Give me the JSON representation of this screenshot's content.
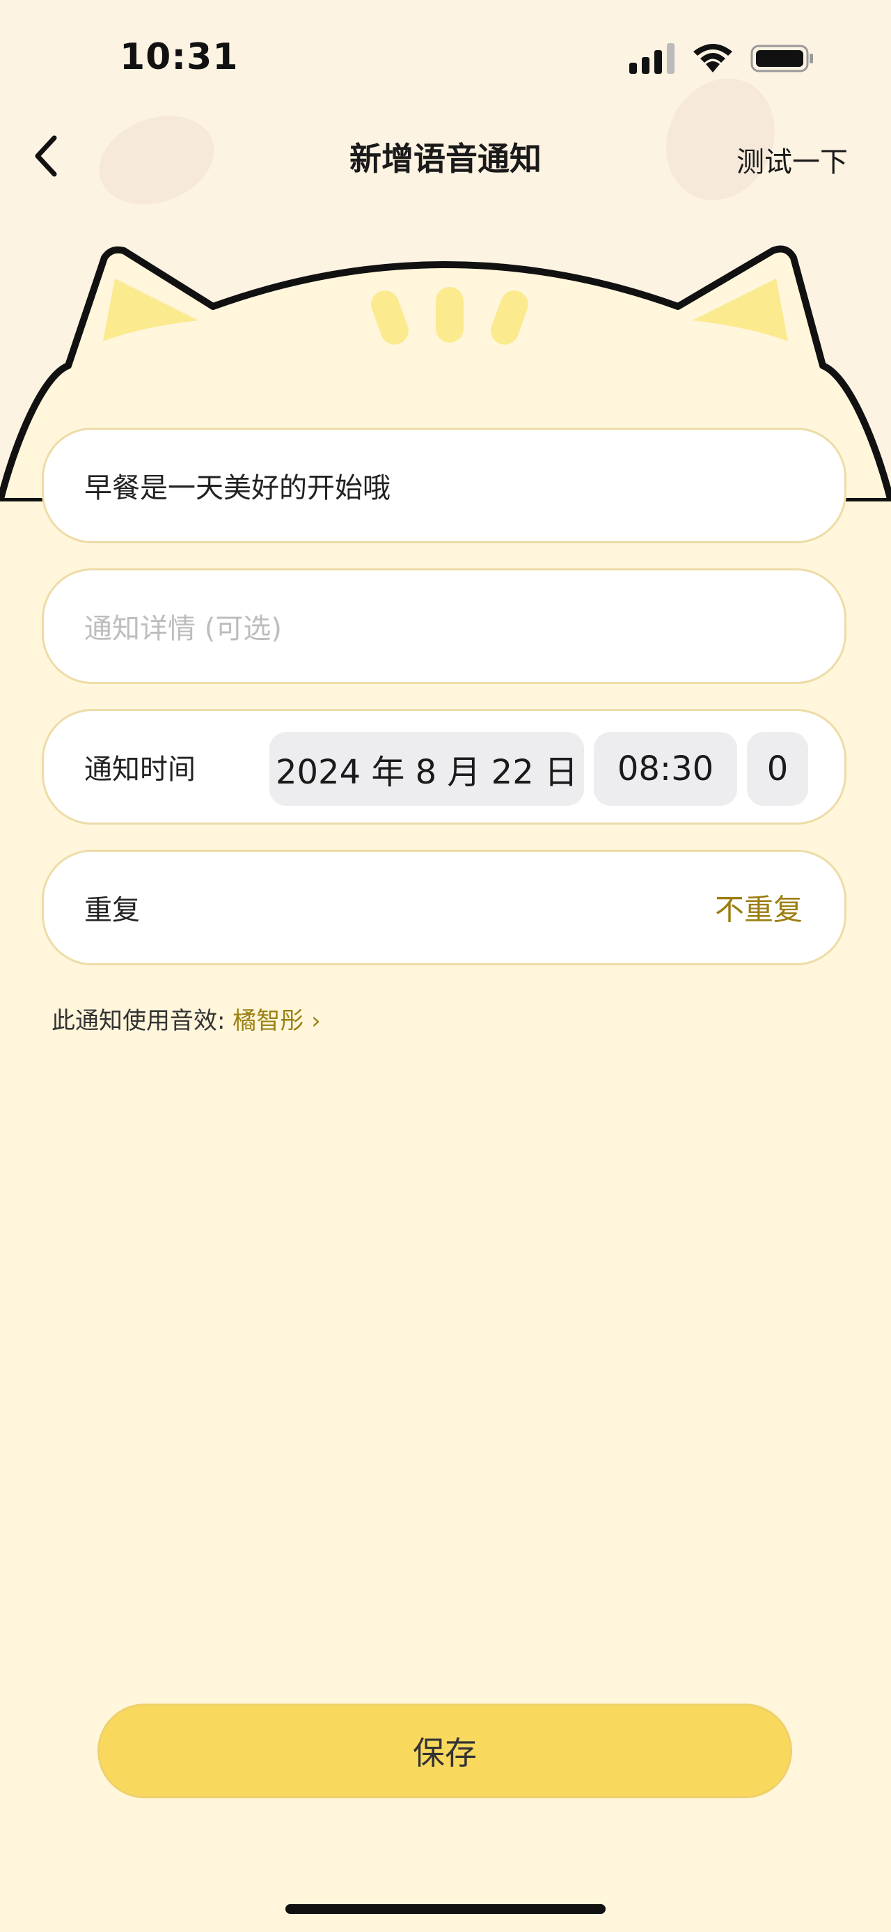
{
  "status_bar": {
    "time": "10:31"
  },
  "nav": {
    "title": "新增语音通知",
    "action_label": "测试一下"
  },
  "form": {
    "title_field": {
      "value": "早餐是一天美好的开始哦"
    },
    "detail_field": {
      "placeholder": "通知详情 (可选)"
    },
    "time_row": {
      "label": "通知时间",
      "date": "2024 年 8 月 22 日",
      "time": "08:30",
      "extra": "0"
    },
    "repeat_row": {
      "label": "重复",
      "value": "不重复"
    }
  },
  "sound": {
    "prefix": "此通知使用音效: ",
    "name": "橘智彤",
    "chevron": "›"
  },
  "save_label": "保存",
  "colors": {
    "accent": "#F9D85E",
    "accent_text": "#9C7E10",
    "background": "#FFF6DC"
  }
}
